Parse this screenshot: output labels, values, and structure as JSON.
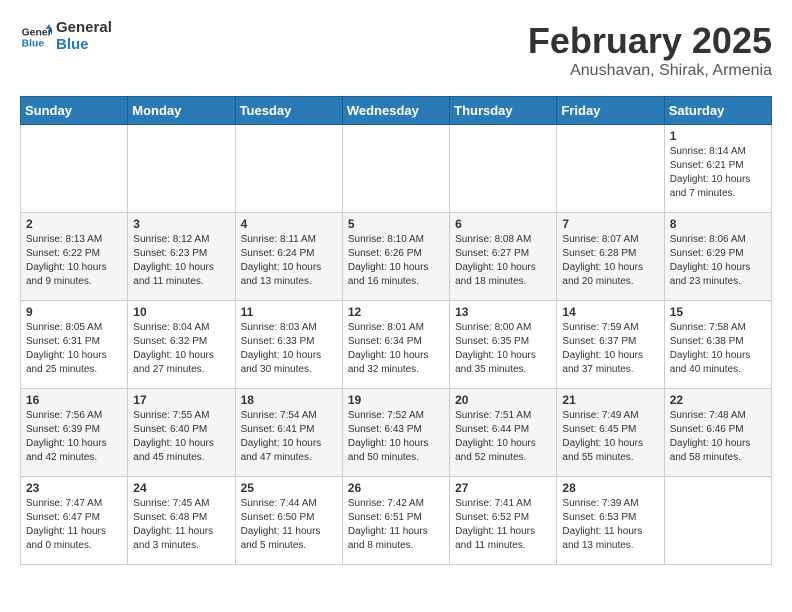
{
  "header": {
    "logo_line1": "General",
    "logo_line2": "Blue",
    "title": "February 2025",
    "subtitle": "Anushavan, Shirak, Armenia"
  },
  "weekdays": [
    "Sunday",
    "Monday",
    "Tuesday",
    "Wednesday",
    "Thursday",
    "Friday",
    "Saturday"
  ],
  "weeks": [
    [
      {
        "day": "",
        "info": ""
      },
      {
        "day": "",
        "info": ""
      },
      {
        "day": "",
        "info": ""
      },
      {
        "day": "",
        "info": ""
      },
      {
        "day": "",
        "info": ""
      },
      {
        "day": "",
        "info": ""
      },
      {
        "day": "1",
        "info": "Sunrise: 8:14 AM\nSunset: 6:21 PM\nDaylight: 10 hours\nand 7 minutes."
      }
    ],
    [
      {
        "day": "2",
        "info": "Sunrise: 8:13 AM\nSunset: 6:22 PM\nDaylight: 10 hours\nand 9 minutes."
      },
      {
        "day": "3",
        "info": "Sunrise: 8:12 AM\nSunset: 6:23 PM\nDaylight: 10 hours\nand 11 minutes."
      },
      {
        "day": "4",
        "info": "Sunrise: 8:11 AM\nSunset: 6:24 PM\nDaylight: 10 hours\nand 13 minutes."
      },
      {
        "day": "5",
        "info": "Sunrise: 8:10 AM\nSunset: 6:26 PM\nDaylight: 10 hours\nand 16 minutes."
      },
      {
        "day": "6",
        "info": "Sunrise: 8:08 AM\nSunset: 6:27 PM\nDaylight: 10 hours\nand 18 minutes."
      },
      {
        "day": "7",
        "info": "Sunrise: 8:07 AM\nSunset: 6:28 PM\nDaylight: 10 hours\nand 20 minutes."
      },
      {
        "day": "8",
        "info": "Sunrise: 8:06 AM\nSunset: 6:29 PM\nDaylight: 10 hours\nand 23 minutes."
      }
    ],
    [
      {
        "day": "9",
        "info": "Sunrise: 8:05 AM\nSunset: 6:31 PM\nDaylight: 10 hours\nand 25 minutes."
      },
      {
        "day": "10",
        "info": "Sunrise: 8:04 AM\nSunset: 6:32 PM\nDaylight: 10 hours\nand 27 minutes."
      },
      {
        "day": "11",
        "info": "Sunrise: 8:03 AM\nSunset: 6:33 PM\nDaylight: 10 hours\nand 30 minutes."
      },
      {
        "day": "12",
        "info": "Sunrise: 8:01 AM\nSunset: 6:34 PM\nDaylight: 10 hours\nand 32 minutes."
      },
      {
        "day": "13",
        "info": "Sunrise: 8:00 AM\nSunset: 6:35 PM\nDaylight: 10 hours\nand 35 minutes."
      },
      {
        "day": "14",
        "info": "Sunrise: 7:59 AM\nSunset: 6:37 PM\nDaylight: 10 hours\nand 37 minutes."
      },
      {
        "day": "15",
        "info": "Sunrise: 7:58 AM\nSunset: 6:38 PM\nDaylight: 10 hours\nand 40 minutes."
      }
    ],
    [
      {
        "day": "16",
        "info": "Sunrise: 7:56 AM\nSunset: 6:39 PM\nDaylight: 10 hours\nand 42 minutes."
      },
      {
        "day": "17",
        "info": "Sunrise: 7:55 AM\nSunset: 6:40 PM\nDaylight: 10 hours\nand 45 minutes."
      },
      {
        "day": "18",
        "info": "Sunrise: 7:54 AM\nSunset: 6:41 PM\nDaylight: 10 hours\nand 47 minutes."
      },
      {
        "day": "19",
        "info": "Sunrise: 7:52 AM\nSunset: 6:43 PM\nDaylight: 10 hours\nand 50 minutes."
      },
      {
        "day": "20",
        "info": "Sunrise: 7:51 AM\nSunset: 6:44 PM\nDaylight: 10 hours\nand 52 minutes."
      },
      {
        "day": "21",
        "info": "Sunrise: 7:49 AM\nSunset: 6:45 PM\nDaylight: 10 hours\nand 55 minutes."
      },
      {
        "day": "22",
        "info": "Sunrise: 7:48 AM\nSunset: 6:46 PM\nDaylight: 10 hours\nand 58 minutes."
      }
    ],
    [
      {
        "day": "23",
        "info": "Sunrise: 7:47 AM\nSunset: 6:47 PM\nDaylight: 11 hours\nand 0 minutes."
      },
      {
        "day": "24",
        "info": "Sunrise: 7:45 AM\nSunset: 6:48 PM\nDaylight: 11 hours\nand 3 minutes."
      },
      {
        "day": "25",
        "info": "Sunrise: 7:44 AM\nSunset: 6:50 PM\nDaylight: 11 hours\nand 5 minutes."
      },
      {
        "day": "26",
        "info": "Sunrise: 7:42 AM\nSunset: 6:51 PM\nDaylight: 11 hours\nand 8 minutes."
      },
      {
        "day": "27",
        "info": "Sunrise: 7:41 AM\nSunset: 6:52 PM\nDaylight: 11 hours\nand 11 minutes."
      },
      {
        "day": "28",
        "info": "Sunrise: 7:39 AM\nSunset: 6:53 PM\nDaylight: 11 hours\nand 13 minutes."
      },
      {
        "day": "",
        "info": ""
      }
    ]
  ]
}
